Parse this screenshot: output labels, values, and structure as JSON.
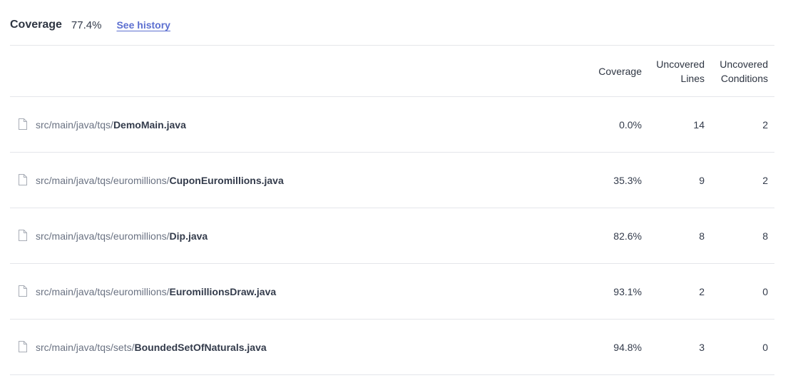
{
  "summary": {
    "label": "Coverage",
    "value": "77.4%",
    "history_link": "See history"
  },
  "table": {
    "columns": {
      "coverage": "Coverage",
      "uncovered_lines_1": "Uncovered",
      "uncovered_lines_2": "Lines",
      "uncovered_conditions_1": "Uncovered",
      "uncovered_conditions_2": "Conditions"
    },
    "rows": [
      {
        "dir": "src/main/java/tqs/",
        "file": "DemoMain.java",
        "coverage": "0.0%",
        "uncovered_lines": "14",
        "uncovered_conditions": "2"
      },
      {
        "dir": "src/main/java/tqs/euromillions/",
        "file": "CuponEuromillions.java",
        "coverage": "35.3%",
        "uncovered_lines": "9",
        "uncovered_conditions": "2"
      },
      {
        "dir": "src/main/java/tqs/euromillions/",
        "file": "Dip.java",
        "coverage": "82.6%",
        "uncovered_lines": "8",
        "uncovered_conditions": "8"
      },
      {
        "dir": "src/main/java/tqs/euromillions/",
        "file": "EuromillionsDraw.java",
        "coverage": "93.1%",
        "uncovered_lines": "2",
        "uncovered_conditions": "0"
      },
      {
        "dir": "src/main/java/tqs/sets/",
        "file": "BoundedSetOfNaturals.java",
        "coverage": "94.8%",
        "uncovered_lines": "3",
        "uncovered_conditions": "0"
      }
    ]
  },
  "icons": {
    "file": "file-icon"
  },
  "colors": {
    "link": "#5c6fd0",
    "text": "#333b4b",
    "muted": "#6a7282",
    "divider": "#e4e6ea"
  }
}
